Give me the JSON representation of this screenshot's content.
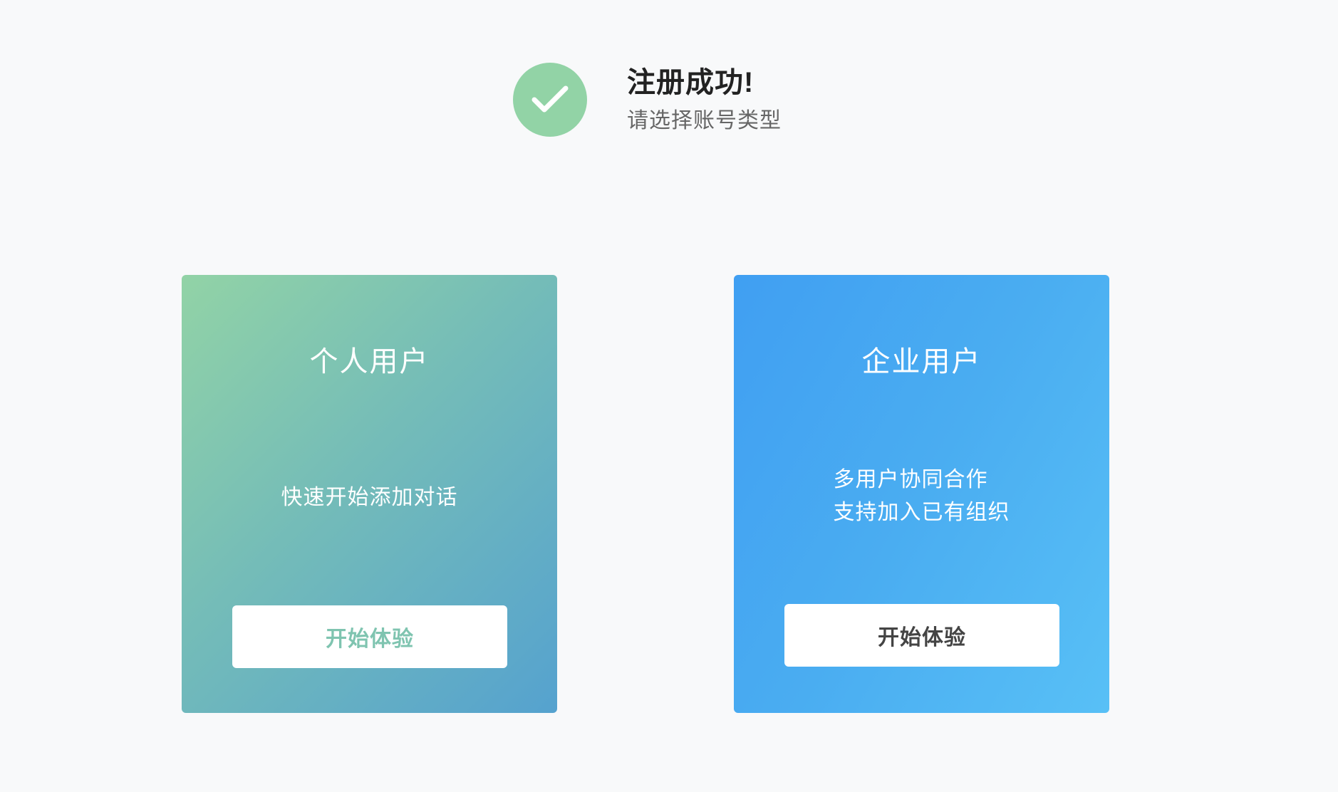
{
  "header": {
    "icon": "check-icon",
    "title": "注册成功!",
    "subtitle": "请选择账号类型"
  },
  "cards": {
    "personal": {
      "title": "个人用户",
      "description": [
        "快速开始添加对话"
      ],
      "button_label": "开始体验"
    },
    "enterprise": {
      "title": "企业用户",
      "description": [
        "多用户协同合作",
        "支持加入已有组织"
      ],
      "button_label": "开始体验"
    }
  },
  "colors": {
    "page_background": "#f8f9fa",
    "success_green": "#92d3a6",
    "personal_gradient": [
      "#92d3a6",
      "#55a2cf"
    ],
    "enterprise_gradient": [
      "#409ff2",
      "#58c0f6"
    ],
    "personal_button_text": "#7fc4b0",
    "enterprise_button_text": "#444444"
  }
}
